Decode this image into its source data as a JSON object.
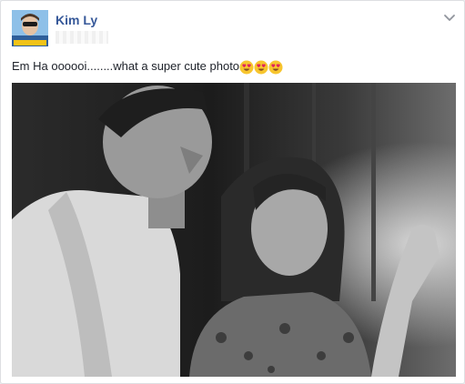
{
  "post": {
    "author": "Kim Ly",
    "avatar_badge": "MEN SAIGON",
    "text": "Em Ha oooooi........what a super cute photo",
    "emoji_count": 3,
    "emoji_name": "heart-eyes"
  },
  "icons": {
    "options": "chevron-down-icon",
    "emoji": "heart-eyes-emoji-icon"
  },
  "colors": {
    "author_link": "#365899",
    "text": "#1d2129",
    "card_border": "#dddfe2",
    "page_bg": "#e9ebee"
  }
}
